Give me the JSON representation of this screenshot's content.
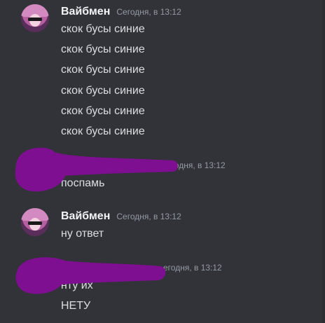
{
  "messages": [
    {
      "username": "Вайбмен",
      "time": "Сегодня, в 13:12",
      "lines": [
        "скок бусы синие",
        "скок бусы синие",
        "скок бусы синие",
        "скок бусы синие",
        "скок бусы синие",
        "скок бусы синие"
      ]
    },
    {
      "time_visible": "егодня, в 13:12",
      "lines": [
        "поспамь"
      ]
    },
    {
      "username": "Вайбмен",
      "time": "Сегодня, в 13:12",
      "lines": [
        "ну ответ"
      ]
    },
    {
      "time_visible": "егодня, в 13:12",
      "lines": [
        "нту их",
        "НЕТУ"
      ]
    }
  ],
  "colors": {
    "background": "#313338",
    "username": "#f2f3f5",
    "message_text": "#dbdee1",
    "timestamp": "#949ba4",
    "redaction_marker": "#7e0f91"
  }
}
